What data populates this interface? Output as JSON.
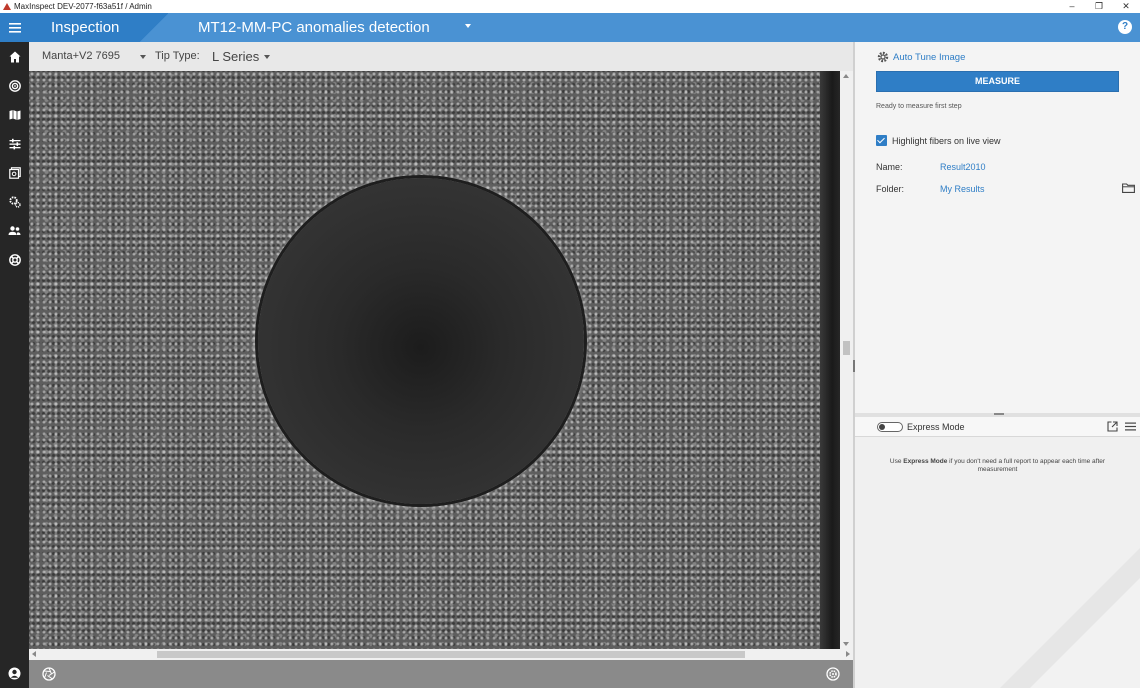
{
  "window": {
    "title_prefix": "MaxInspect DEV-2077-f63a51f",
    "title_suffix": "/ Admin",
    "controls": {
      "minimize": "–",
      "restore": "❐",
      "close": "✕"
    }
  },
  "appbar": {
    "section_title": "Inspection",
    "recipe_title": "MT12-MM-PC anomalies detection",
    "help_label": "?"
  },
  "sidebar": {
    "items": [
      "home-icon",
      "target-icon",
      "map-icon",
      "sliders-icon",
      "gallery-icon",
      "settings-icon",
      "users-icon",
      "support-icon"
    ],
    "bottom": "user-icon"
  },
  "toolbar": {
    "camera": "Manta+V2 7695",
    "tip_type_label": "Tip Type:",
    "tip_type_value": "L Series"
  },
  "right_panel": {
    "auto_tune_label": "Auto Tune Image",
    "measure_label": "MEASURE",
    "status": "Ready to measure first step",
    "highlight_label": "Highlight fibers on live view",
    "highlight_checked": true,
    "name_label": "Name:",
    "name_value": "Result2010",
    "folder_label": "Folder:",
    "folder_value": "My Results"
  },
  "express": {
    "label": "Express Mode",
    "enabled": false,
    "hint_prefix": "Use",
    "hint_bold": "Express Mode",
    "hint_suffix": "if you don't need a full report to appear each time after measurement"
  },
  "colors": {
    "accent": "#2f7ec6",
    "accent_light": "#4a92d3",
    "sidebar": "#262626"
  }
}
